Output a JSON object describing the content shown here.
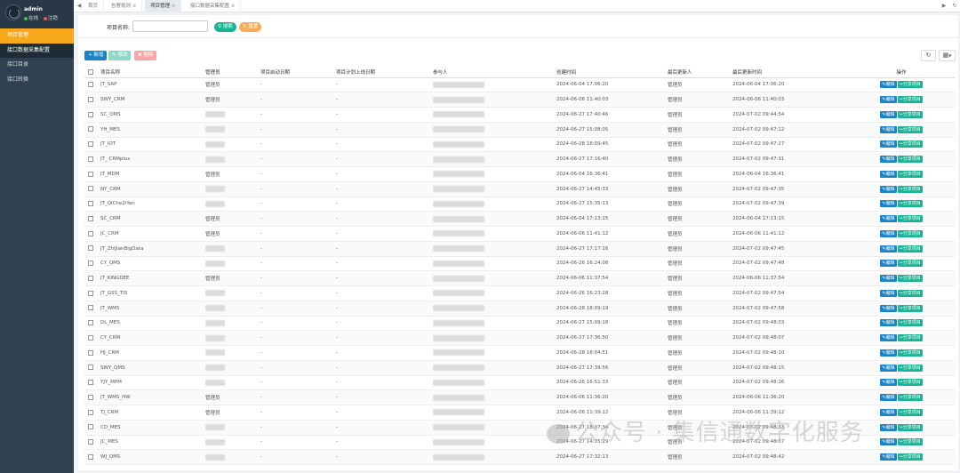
{
  "sidebar": {
    "user": {
      "name": "admin",
      "status_online": "在线",
      "status_logout": "注销"
    },
    "items": [
      {
        "label": "项目管理",
        "state": "active"
      },
      {
        "label": "接口数据采集配置",
        "state": "sub"
      },
      {
        "label": "接口目录",
        "state": ""
      },
      {
        "label": "接口转换",
        "state": ""
      }
    ]
  },
  "topbar": {
    "tabs": [
      {
        "label": "首页",
        "closable": false
      },
      {
        "label": "告警规则",
        "closable": true
      },
      {
        "label": "项目管理",
        "closable": true
      },
      {
        "label": "接口数据采集配置",
        "closable": true
      }
    ]
  },
  "search": {
    "label": "项目名称:",
    "placeholder": "",
    "search_btn": "搜索",
    "reset_btn": "重置"
  },
  "toolbar": {
    "add": "新增",
    "edit": "修改",
    "delete": "删除"
  },
  "table": {
    "headers": [
      "项目名称",
      "管理员",
      "项目启动日期",
      "项目计划上线日期",
      "参与人",
      "创建时间",
      "最后更新人",
      "最后更新时间",
      "操作"
    ],
    "edit_label": "编辑",
    "share_label": "分享项目",
    "rows": [
      {
        "name": "JT_SAP",
        "admin": "管理员",
        "start": "-",
        "plan": "-",
        "created": "2024-06-04 17:06:20",
        "updater": "管理员",
        "updated": "2024-06-04 17:06:20"
      },
      {
        "name": "SWY_CRM",
        "admin": "管理员",
        "start": "-",
        "plan": "-",
        "created": "2024-06-06 11:40:03",
        "updater": "管理员",
        "updated": "2024-06-06 11:40:03"
      },
      {
        "name": "SC_QMS",
        "admin": "",
        "start": "-",
        "plan": "-",
        "created": "2024-06-27 17:40:46",
        "updater": "管理员",
        "updated": "2024-07-02 09:44:54"
      },
      {
        "name": "YH_MES",
        "admin": "",
        "start": "-",
        "plan": "-",
        "created": "2024-06-27 15:08:05",
        "updater": "管理员",
        "updated": "2024-07-02 09:47:12"
      },
      {
        "name": "JT_IOT",
        "admin": "",
        "start": "-",
        "plan": "-",
        "created": "2024-06-28 18:09:45",
        "updater": "管理员",
        "updated": "2024-07-02 09:47:27"
      },
      {
        "name": "JT_ CRMplus",
        "admin": "",
        "start": "-",
        "plan": "-",
        "created": "2024-06-27 17:16:40",
        "updater": "管理员",
        "updated": "2024-07-02 09:47:31"
      },
      {
        "name": "JT_MDM",
        "admin": "管理员",
        "start": "-",
        "plan": "-",
        "created": "2024-06-04 16:36:41",
        "updater": "管理员",
        "updated": "2024-06-04 16:36:41"
      },
      {
        "name": "NY_CRM",
        "admin": "",
        "start": "-",
        "plan": "-",
        "created": "2024-06-27 14:45:33",
        "updater": "管理员",
        "updated": "2024-07-02 09:47:35"
      },
      {
        "name": "JT_QiChe2iYan",
        "admin": "",
        "start": "-",
        "plan": "-",
        "created": "2024-06-27 15:35:13",
        "updater": "管理员",
        "updated": "2024-07-02 09:47:39"
      },
      {
        "name": "SC_CRM",
        "admin": "管理员",
        "start": "-",
        "plan": "-",
        "created": "2024-06-04 17:13:15",
        "updater": "管理员",
        "updated": "2024-06-04 17:13:15"
      },
      {
        "name": "JC_CRM",
        "admin": "管理员",
        "start": "-",
        "plan": "-",
        "created": "2024-06-06 11:41:12",
        "updater": "管理员",
        "updated": "2024-06-06 11:41:12"
      },
      {
        "name": "JT_ZhiJianBigData",
        "admin": "",
        "start": "-",
        "plan": "-",
        "created": "2024-06-27 17:17:16",
        "updater": "管理员",
        "updated": "2024-07-02 09:47:45"
      },
      {
        "name": "CY_QMS",
        "admin": "",
        "start": "-",
        "plan": "-",
        "created": "2024-06-26 16:24:08",
        "updater": "管理员",
        "updated": "2024-07-02 09:47:48"
      },
      {
        "name": "JT_KINGDEE",
        "admin": "管理员",
        "start": "-",
        "plan": "-",
        "created": "2024-06-06 11:37:54",
        "updater": "管理员",
        "updated": "2024-06-06 11:37:54"
      },
      {
        "name": "JT_GSS_TIS",
        "admin": "",
        "start": "-",
        "plan": "-",
        "created": "2024-06-26 16:23:28",
        "updater": "管理员",
        "updated": "2024-07-02 09:47:54"
      },
      {
        "name": "JT_WMS",
        "admin": "",
        "start": "-",
        "plan": "-",
        "created": "2024-06-28 18:09:19",
        "updater": "管理员",
        "updated": "2024-07-02 09:47:58"
      },
      {
        "name": "DL_MES",
        "admin": "",
        "start": "-",
        "plan": "-",
        "created": "2024-06-27 15:09:18",
        "updater": "管理员",
        "updated": "2024-07-02 09:48:03"
      },
      {
        "name": "CY_CRM",
        "admin": "",
        "start": "-",
        "plan": "-",
        "created": "2024-06-27 17:36:50",
        "updater": "管理员",
        "updated": "2024-07-02 09:48:07"
      },
      {
        "name": "HJ_CRM",
        "admin": "",
        "start": "-",
        "plan": "-",
        "created": "2024-06-28 18:04:51",
        "updater": "管理员",
        "updated": "2024-07-02 09:48:10"
      },
      {
        "name": "SWY_QMS",
        "admin": "",
        "start": "-",
        "plan": "-",
        "created": "2024-06-27 17:39:56",
        "updater": "管理员",
        "updated": "2024-07-02 09:48:15"
      },
      {
        "name": "YJY_MPM",
        "admin": "",
        "start": "-",
        "plan": "-",
        "created": "2024-06-26 16:51:33",
        "updater": "管理员",
        "updated": "2024-07-02 09:48:26"
      },
      {
        "name": "JT_WMS_HW",
        "admin": "管理员",
        "start": "-",
        "plan": "-",
        "created": "2024-06-06 11:36:20",
        "updater": "管理员",
        "updated": "2024-06-06 11:36:20"
      },
      {
        "name": "TJ_CRM",
        "admin": "管理员",
        "start": "-",
        "plan": "-",
        "created": "2024-06-06 11:39:12",
        "updater": "管理员",
        "updated": "2024-06-06 11:39:12"
      },
      {
        "name": "CD_MES",
        "admin": "",
        "start": "-",
        "plan": "-",
        "created": "2024-06-27 18:07:34",
        "updater": "管理员",
        "updated": "2024-07-02 09:48:33"
      },
      {
        "name": "JC_MES",
        "admin": "",
        "start": "-",
        "plan": "-",
        "created": "2024-06-27 14:35:29",
        "updater": "管理员",
        "updated": "2024-07-02 09:48:37"
      },
      {
        "name": "WJ_QMS",
        "admin": "",
        "start": "-",
        "plan": "-",
        "created": "2024-06-27 17:32:13",
        "updater": "管理员",
        "updated": "2024-07-02 09:48:42"
      }
    ]
  },
  "watermark": "公众号 · 集信通数字化服务",
  "colors": {
    "sidebar": "#2f4050",
    "active_menu": "#f7a81b",
    "primary": "#1c84c6",
    "success": "#1ab394",
    "warning": "#f8ac59",
    "danger": "#ed5565"
  }
}
